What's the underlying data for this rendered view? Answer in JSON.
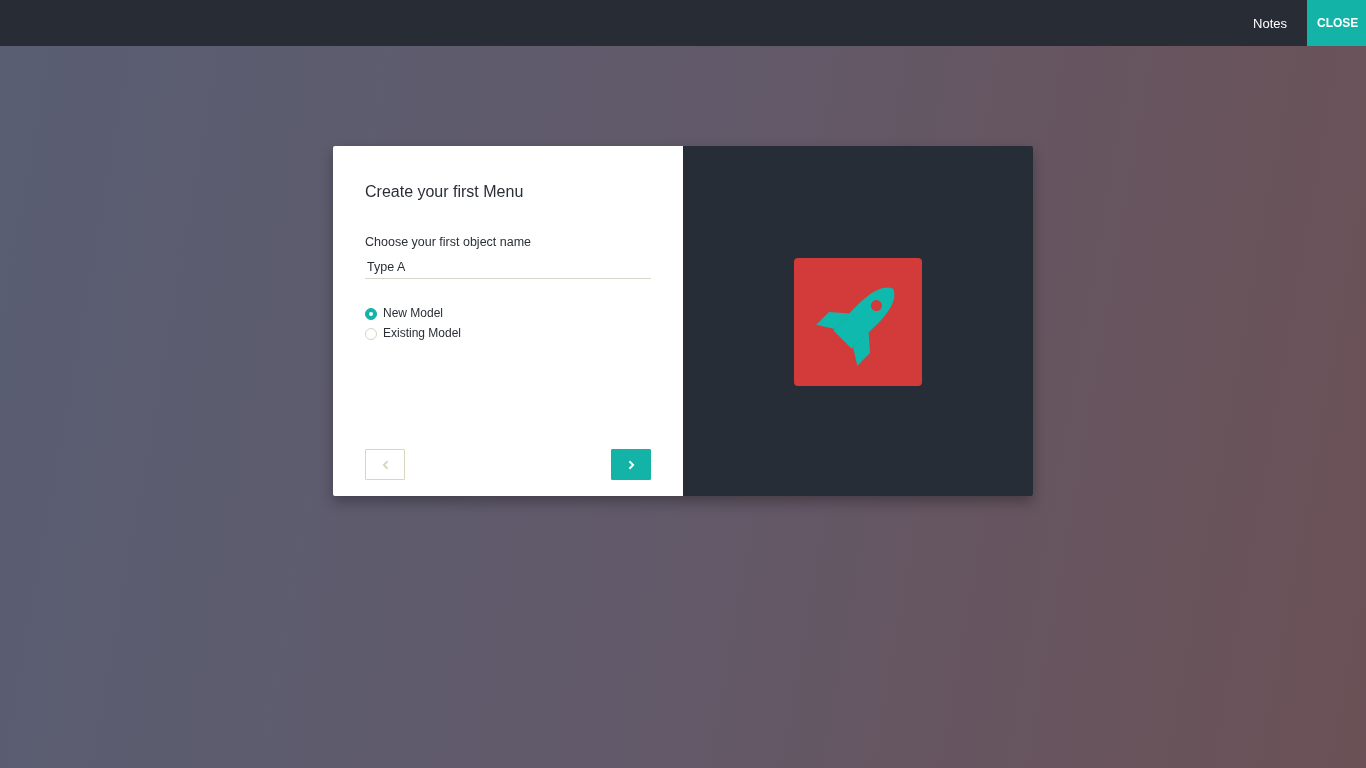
{
  "top_bar": {
    "links": [
      {
        "label": "Notes"
      }
    ],
    "close_button": {
      "label": "CLOSE"
    }
  },
  "dialog": {
    "title": "Create your first Menu",
    "field": {
      "label": "Choose your first object name",
      "value": "Type A"
    },
    "options": [
      {
        "label": "New Model",
        "selected": true
      },
      {
        "label": "Existing Model",
        "selected": false
      }
    ],
    "back_button": {
      "disabled": true
    },
    "next_button": {
      "disabled": false
    }
  }
}
